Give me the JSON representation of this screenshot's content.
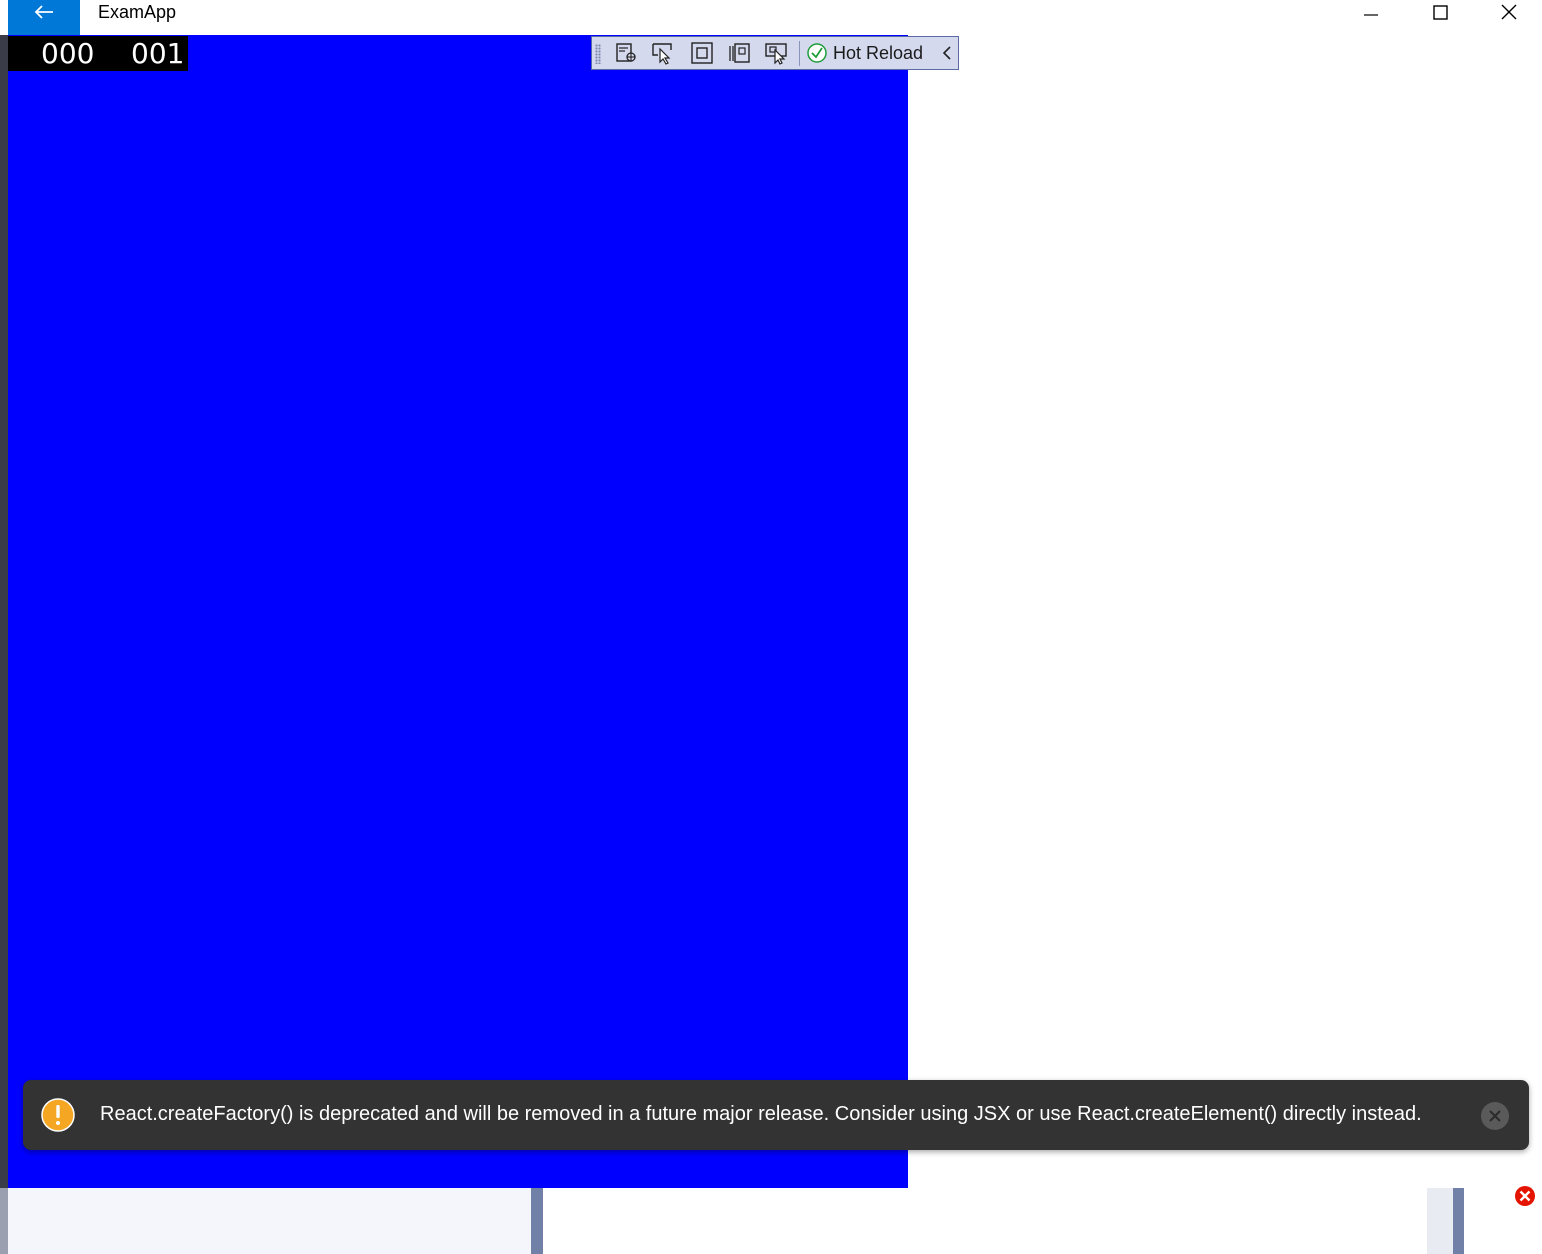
{
  "window": {
    "title": "ExamApp"
  },
  "counters": [
    "000",
    "001"
  ],
  "toolbar": {
    "hot_reload_label": "Hot Reload",
    "buttons": [
      "live-visual-tree-icon",
      "select-element-icon",
      "display-layout-adorners-icon",
      "track-focus-icon",
      "preview-selection-icon"
    ]
  },
  "toast": {
    "message": "React.createFactory() is deprecated and will be removed in a future major release. Consider using JSX or use React.createElement() directly instead."
  },
  "colors": {
    "content_bg": "#0000ff",
    "accent": "#0078d7",
    "toast_bg": "#333333",
    "warning": "#f5a623",
    "hot_reload_ok": "#1f9d3a"
  }
}
